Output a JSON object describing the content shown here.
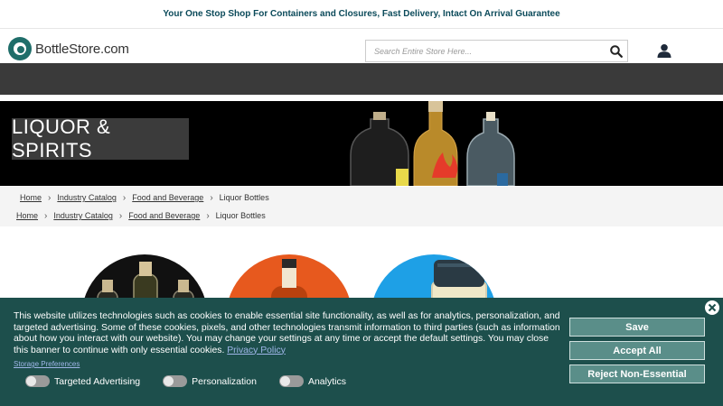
{
  "promo": {
    "text": "Your One Stop Shop For Containers and Closures, Fast Delivery, Intact On Arrival Guarantee"
  },
  "header": {
    "logo_text": "BottleStore.com",
    "search_placeholder": "Search Entire Store Here...",
    "search_icon": "search-icon",
    "account_icon": "user-icon"
  },
  "hero": {
    "title": "LIQUOR & SPIRITS"
  },
  "breadcrumbs": [
    {
      "label": "Home"
    },
    {
      "label": "Industry Catalog"
    },
    {
      "label": "Food and Beverage"
    },
    {
      "label": "Liquor Bottles"
    }
  ],
  "cookie_banner": {
    "text": "This website utilizes technologies such as cookies to enable essential site functionality, as well as for analytics, personalization, and targeted advertising. Some of these cookies, pixels, and other technologies transmit information to third parties (such as information about how you interact with our website). You may change your settings at any time or accept the default settings. You may close this banner to continue with only essential cookies.",
    "privacy_link": "Privacy Policy",
    "storage_link": "Storage Preferences",
    "toggles": [
      {
        "label": "Targeted Advertising",
        "on": false
      },
      {
        "label": "Personalization",
        "on": false
      },
      {
        "label": "Analytics",
        "on": false
      }
    ],
    "buttons": {
      "save": "Save",
      "accept": "Accept All",
      "reject": "Reject Non-Essential"
    }
  },
  "colors": {
    "brand": "#1f6e6a",
    "banner_bg": "#1d4f4c",
    "button_bg": "#5a8e89",
    "promo_text": "#0b4a5a"
  }
}
